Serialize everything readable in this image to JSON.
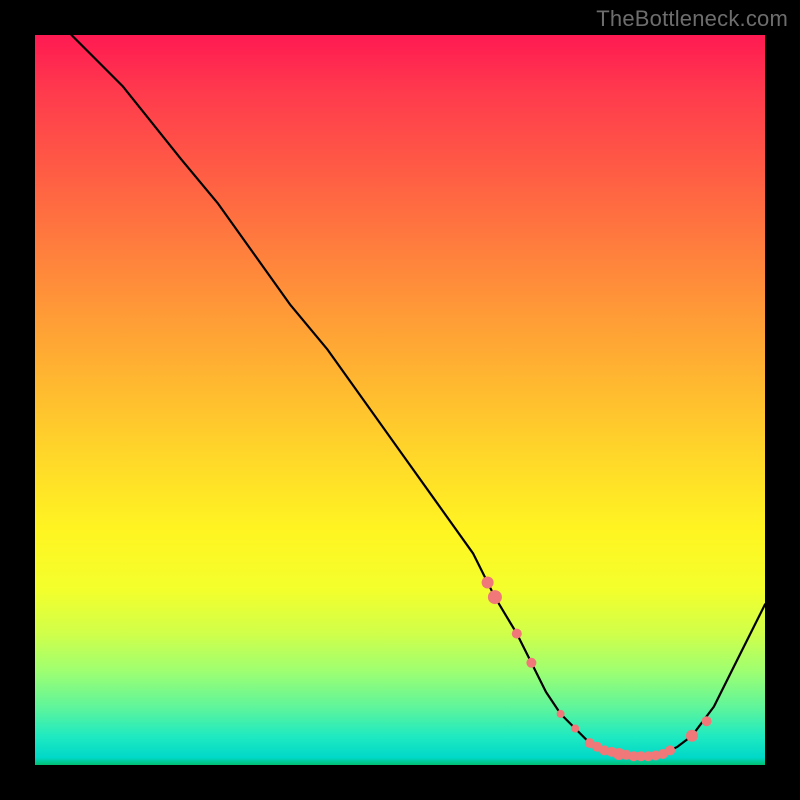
{
  "watermark": "TheBottleneck.com",
  "colors": {
    "frame": "#000000",
    "curve": "#000000",
    "dots": "#f07878"
  },
  "chart_data": {
    "type": "line",
    "title": "",
    "xlabel": "",
    "ylabel": "",
    "xlim": [
      0,
      100
    ],
    "ylim": [
      0,
      100
    ],
    "series": [
      {
        "name": "bottleneck-curve",
        "x": [
          5,
          8,
          12,
          16,
          20,
          25,
          30,
          35,
          40,
          45,
          50,
          55,
          60,
          63,
          66,
          68,
          70,
          72,
          74,
          76,
          78,
          80,
          82,
          84,
          86,
          88,
          90,
          93,
          96,
          100
        ],
        "y": [
          100,
          97,
          93,
          88,
          83,
          77,
          70,
          63,
          57,
          50,
          43,
          36,
          29,
          23,
          18,
          14,
          10,
          7,
          5,
          3,
          2,
          1.5,
          1.2,
          1.2,
          1.5,
          2.5,
          4,
          8,
          14,
          22
        ]
      }
    ],
    "dots": {
      "name": "highlight-dots",
      "x": [
        62,
        63,
        66,
        68,
        72,
        74,
        76,
        77,
        78,
        79,
        80,
        81,
        82,
        83,
        84,
        85,
        86,
        87,
        90,
        92
      ],
      "y": [
        25,
        23,
        18,
        14,
        7,
        5,
        3,
        2.5,
        2,
        1.8,
        1.5,
        1.4,
        1.2,
        1.2,
        1.2,
        1.3,
        1.5,
        2,
        4,
        6
      ],
      "r": [
        6,
        7,
        5,
        5,
        4,
        4,
        5,
        5,
        5,
        5,
        6,
        5,
        5,
        5,
        5,
        5,
        5,
        5,
        6,
        5
      ]
    }
  }
}
